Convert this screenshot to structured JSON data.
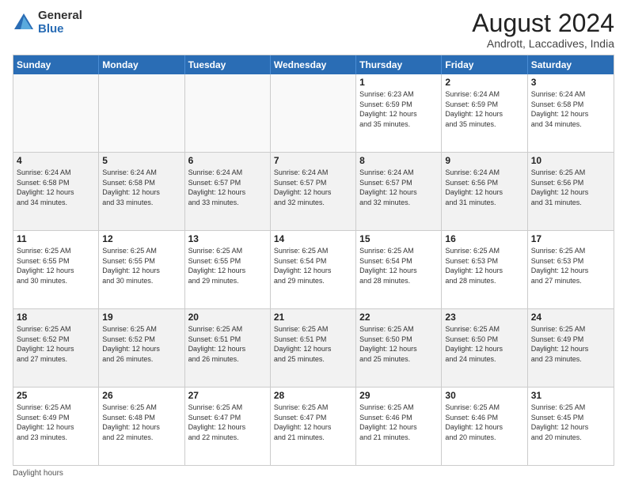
{
  "logo": {
    "general": "General",
    "blue": "Blue"
  },
  "title": "August 2024",
  "location": "Andrott, Laccadives, India",
  "days": [
    "Sunday",
    "Monday",
    "Tuesday",
    "Wednesday",
    "Thursday",
    "Friday",
    "Saturday"
  ],
  "weeks": [
    [
      {
        "day": "",
        "text": ""
      },
      {
        "day": "",
        "text": ""
      },
      {
        "day": "",
        "text": ""
      },
      {
        "day": "",
        "text": ""
      },
      {
        "day": "1",
        "text": "Sunrise: 6:23 AM\nSunset: 6:59 PM\nDaylight: 12 hours\nand 35 minutes."
      },
      {
        "day": "2",
        "text": "Sunrise: 6:24 AM\nSunset: 6:59 PM\nDaylight: 12 hours\nand 35 minutes."
      },
      {
        "day": "3",
        "text": "Sunrise: 6:24 AM\nSunset: 6:58 PM\nDaylight: 12 hours\nand 34 minutes."
      }
    ],
    [
      {
        "day": "4",
        "text": "Sunrise: 6:24 AM\nSunset: 6:58 PM\nDaylight: 12 hours\nand 34 minutes."
      },
      {
        "day": "5",
        "text": "Sunrise: 6:24 AM\nSunset: 6:58 PM\nDaylight: 12 hours\nand 33 minutes."
      },
      {
        "day": "6",
        "text": "Sunrise: 6:24 AM\nSunset: 6:57 PM\nDaylight: 12 hours\nand 33 minutes."
      },
      {
        "day": "7",
        "text": "Sunrise: 6:24 AM\nSunset: 6:57 PM\nDaylight: 12 hours\nand 32 minutes."
      },
      {
        "day": "8",
        "text": "Sunrise: 6:24 AM\nSunset: 6:57 PM\nDaylight: 12 hours\nand 32 minutes."
      },
      {
        "day": "9",
        "text": "Sunrise: 6:24 AM\nSunset: 6:56 PM\nDaylight: 12 hours\nand 31 minutes."
      },
      {
        "day": "10",
        "text": "Sunrise: 6:25 AM\nSunset: 6:56 PM\nDaylight: 12 hours\nand 31 minutes."
      }
    ],
    [
      {
        "day": "11",
        "text": "Sunrise: 6:25 AM\nSunset: 6:55 PM\nDaylight: 12 hours\nand 30 minutes."
      },
      {
        "day": "12",
        "text": "Sunrise: 6:25 AM\nSunset: 6:55 PM\nDaylight: 12 hours\nand 30 minutes."
      },
      {
        "day": "13",
        "text": "Sunrise: 6:25 AM\nSunset: 6:55 PM\nDaylight: 12 hours\nand 29 minutes."
      },
      {
        "day": "14",
        "text": "Sunrise: 6:25 AM\nSunset: 6:54 PM\nDaylight: 12 hours\nand 29 minutes."
      },
      {
        "day": "15",
        "text": "Sunrise: 6:25 AM\nSunset: 6:54 PM\nDaylight: 12 hours\nand 28 minutes."
      },
      {
        "day": "16",
        "text": "Sunrise: 6:25 AM\nSunset: 6:53 PM\nDaylight: 12 hours\nand 28 minutes."
      },
      {
        "day": "17",
        "text": "Sunrise: 6:25 AM\nSunset: 6:53 PM\nDaylight: 12 hours\nand 27 minutes."
      }
    ],
    [
      {
        "day": "18",
        "text": "Sunrise: 6:25 AM\nSunset: 6:52 PM\nDaylight: 12 hours\nand 27 minutes."
      },
      {
        "day": "19",
        "text": "Sunrise: 6:25 AM\nSunset: 6:52 PM\nDaylight: 12 hours\nand 26 minutes."
      },
      {
        "day": "20",
        "text": "Sunrise: 6:25 AM\nSunset: 6:51 PM\nDaylight: 12 hours\nand 26 minutes."
      },
      {
        "day": "21",
        "text": "Sunrise: 6:25 AM\nSunset: 6:51 PM\nDaylight: 12 hours\nand 25 minutes."
      },
      {
        "day": "22",
        "text": "Sunrise: 6:25 AM\nSunset: 6:50 PM\nDaylight: 12 hours\nand 25 minutes."
      },
      {
        "day": "23",
        "text": "Sunrise: 6:25 AM\nSunset: 6:50 PM\nDaylight: 12 hours\nand 24 minutes."
      },
      {
        "day": "24",
        "text": "Sunrise: 6:25 AM\nSunset: 6:49 PM\nDaylight: 12 hours\nand 23 minutes."
      }
    ],
    [
      {
        "day": "25",
        "text": "Sunrise: 6:25 AM\nSunset: 6:49 PM\nDaylight: 12 hours\nand 23 minutes."
      },
      {
        "day": "26",
        "text": "Sunrise: 6:25 AM\nSunset: 6:48 PM\nDaylight: 12 hours\nand 22 minutes."
      },
      {
        "day": "27",
        "text": "Sunrise: 6:25 AM\nSunset: 6:47 PM\nDaylight: 12 hours\nand 22 minutes."
      },
      {
        "day": "28",
        "text": "Sunrise: 6:25 AM\nSunset: 6:47 PM\nDaylight: 12 hours\nand 21 minutes."
      },
      {
        "day": "29",
        "text": "Sunrise: 6:25 AM\nSunset: 6:46 PM\nDaylight: 12 hours\nand 21 minutes."
      },
      {
        "day": "30",
        "text": "Sunrise: 6:25 AM\nSunset: 6:46 PM\nDaylight: 12 hours\nand 20 minutes."
      },
      {
        "day": "31",
        "text": "Sunrise: 6:25 AM\nSunset: 6:45 PM\nDaylight: 12 hours\nand 20 minutes."
      }
    ]
  ],
  "footer": "Daylight hours"
}
